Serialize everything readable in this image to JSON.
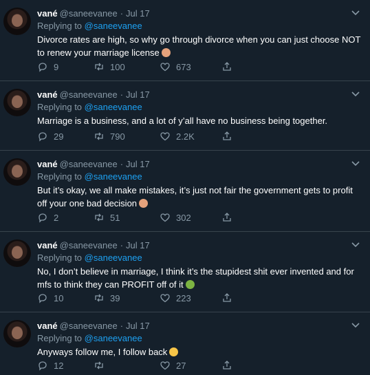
{
  "tweets": [
    {
      "name": "vané",
      "handle": "@saneevanee",
      "date": "Jul 17",
      "reply_prefix": "Replying to",
      "reply_to": "@saneevanee",
      "text": "Divorce rates are high, so why go through divorce when you can just choose NOT to renew your marriage license",
      "emoji": "person-gesturing-no-emoji",
      "replies": "9",
      "retweets": "100",
      "likes": "673"
    },
    {
      "name": "vané",
      "handle": "@saneevanee",
      "date": "Jul 17",
      "reply_prefix": "Replying to",
      "reply_to": "@saneevanee",
      "text": "Marriage is a business, and a lot of y’all have no business being together.",
      "emoji": "",
      "replies": "29",
      "retweets": "790",
      "likes": "2.2K"
    },
    {
      "name": "vané",
      "handle": "@saneevanee",
      "date": "Jul 17",
      "reply_prefix": "Replying to",
      "reply_to": "@saneevanee",
      "text": "But it’s okay, we all make mistakes, it’s just not fair the government gets to profit off your one bad decision",
      "emoji": "person-gesturing-no-emoji",
      "replies": "2",
      "retweets": "51",
      "likes": "302"
    },
    {
      "name": "vané",
      "handle": "@saneevanee",
      "date": "Jul 17",
      "reply_prefix": "Replying to",
      "reply_to": "@saneevanee",
      "text": "No, I don’t believe in marriage, I think it’s the stupidest shit ever invented and for mfs to think they can PROFIT off of it",
      "emoji": "nauseated-face-emoji",
      "replies": "10",
      "retweets": "39",
      "likes": "223"
    },
    {
      "name": "vané",
      "handle": "@saneevanee",
      "date": "Jul 17",
      "reply_prefix": "Replying to",
      "reply_to": "@saneevanee",
      "text": "Anyways follow me, I follow back",
      "emoji": "face-blowing-kiss-emoji",
      "replies": "12",
      "retweets": "",
      "likes": "27"
    }
  ],
  "colors": {
    "background": "#15202b",
    "divider": "#38444d",
    "secondary_text": "#8899a6",
    "accent": "#1da1f2"
  }
}
